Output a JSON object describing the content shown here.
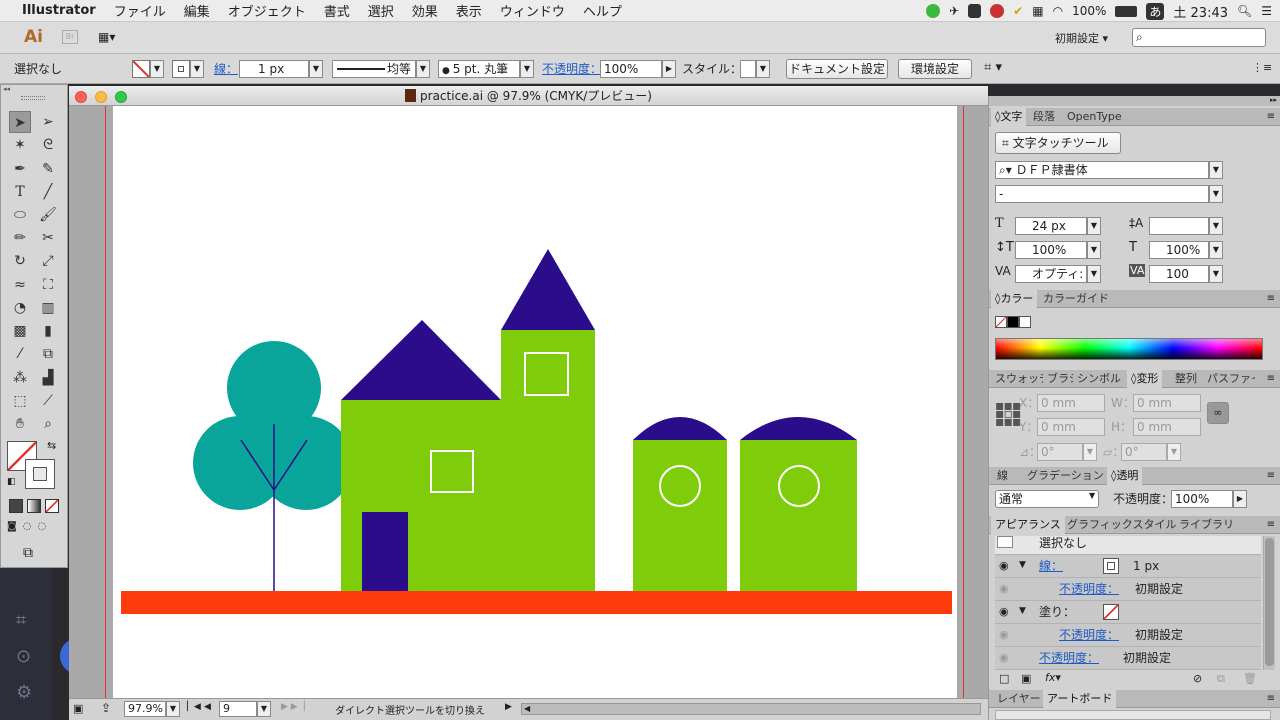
{
  "menubar": {
    "app": "Illustrator",
    "items": [
      "ファイル",
      "編集",
      "オブジェクト",
      "書式",
      "選択",
      "効果",
      "表示",
      "ウィンドウ",
      "ヘルプ"
    ],
    "battery": "100%",
    "time": "土 23:43",
    "input_method": "あ"
  },
  "appbar": {
    "logo": "Ai",
    "workspace": "初期設定 ▾"
  },
  "control": {
    "selection": "選択なし",
    "stroke_label": "線：",
    "stroke_weight": "1 px",
    "stroke_profile": "均等",
    "brush": "5 pt. 丸筆",
    "opacity_label": "不透明度：",
    "opacity": "100%",
    "style_label": "スタイル：",
    "doc_setup": "ドキュメント設定",
    "preferences": "環境設定"
  },
  "document": {
    "title": "practice.ai @ 97.9% (CMYK/プレビュー)",
    "zoom": "97.9%",
    "artboard_num": "9",
    "status": "ダイレクト選択ツールを切り換え"
  },
  "panels": {
    "type": {
      "tabs": [
        "文字",
        "段落",
        "OpenType"
      ],
      "touch_tool": "文字タッチツール",
      "font": "ＤＦＰ隷書体",
      "font_style": "-",
      "size": "24 px",
      "leading": "",
      "vscale": "100%",
      "hscale": "100%",
      "kerning": "オプティ:",
      "tracking": "100"
    },
    "color": {
      "tabs": [
        "カラー",
        "カラーガイド"
      ]
    },
    "transform": {
      "tabs": [
        "スウォッチ",
        "ブラシ",
        "シンボル",
        "変形",
        "整列",
        "パスファインダー"
      ],
      "x": "0 mm",
      "y": "0 mm",
      "w": "0 mm",
      "h": "0 mm",
      "angle": "0°",
      "shear": "0°"
    },
    "transparency": {
      "tabs": [
        "線",
        "グラデーション",
        "透明"
      ],
      "blend": "通常",
      "opacity_label": "不透明度：",
      "opacity": "100%"
    },
    "appearance": {
      "tabs": [
        "アピアランス",
        "グラフィックスタイル",
        "ライブラリ"
      ],
      "header": "選択なし",
      "stroke_label": "線：",
      "stroke_value": "1 px",
      "opacity_label": "不透明度：",
      "opacity_value": "初期設定",
      "fill_label": "塗り：",
      "fill_opacity_label": "不透明度：",
      "fill_opacity_value": "初期設定",
      "obj_opacity_label": "不透明度：",
      "obj_opacity_value": "初期設定"
    },
    "layers": {
      "tabs": [
        "レイヤー",
        "アートボード"
      ]
    }
  },
  "colors": {
    "green": "#7ecc0a",
    "navy": "#2b0c8a",
    "teal": "#0aa59a",
    "orange": "#ff3a0c",
    "guide": "#e0322a"
  }
}
